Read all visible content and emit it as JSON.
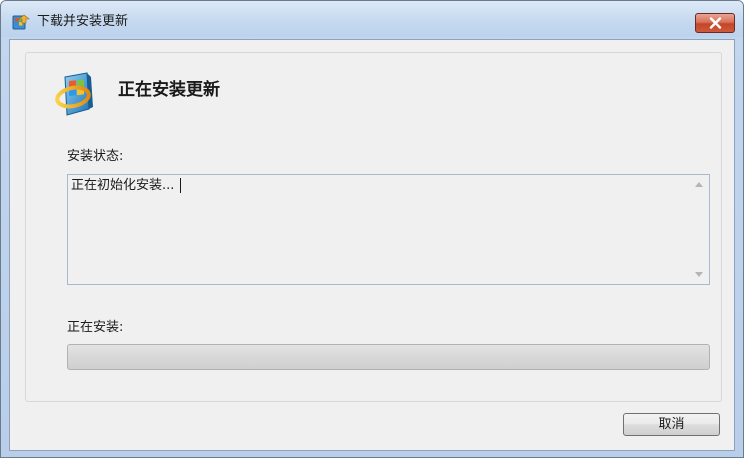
{
  "window": {
    "title": "下载并安装更新",
    "icon": "windows-update-icon",
    "close_icon": "close-icon"
  },
  "header": {
    "title": "正在安装更新",
    "icon": "windows-update-icon"
  },
  "status": {
    "label": "安装状态:",
    "text": "正在初始化安装..."
  },
  "install": {
    "label": "正在安装:",
    "progress_fraction": 0
  },
  "buttons": {
    "cancel_label": "取消"
  },
  "colors": {
    "close_button": "#c4452a",
    "panel_background": "#f0f0f0",
    "titlebar": "#c6d9f0"
  }
}
